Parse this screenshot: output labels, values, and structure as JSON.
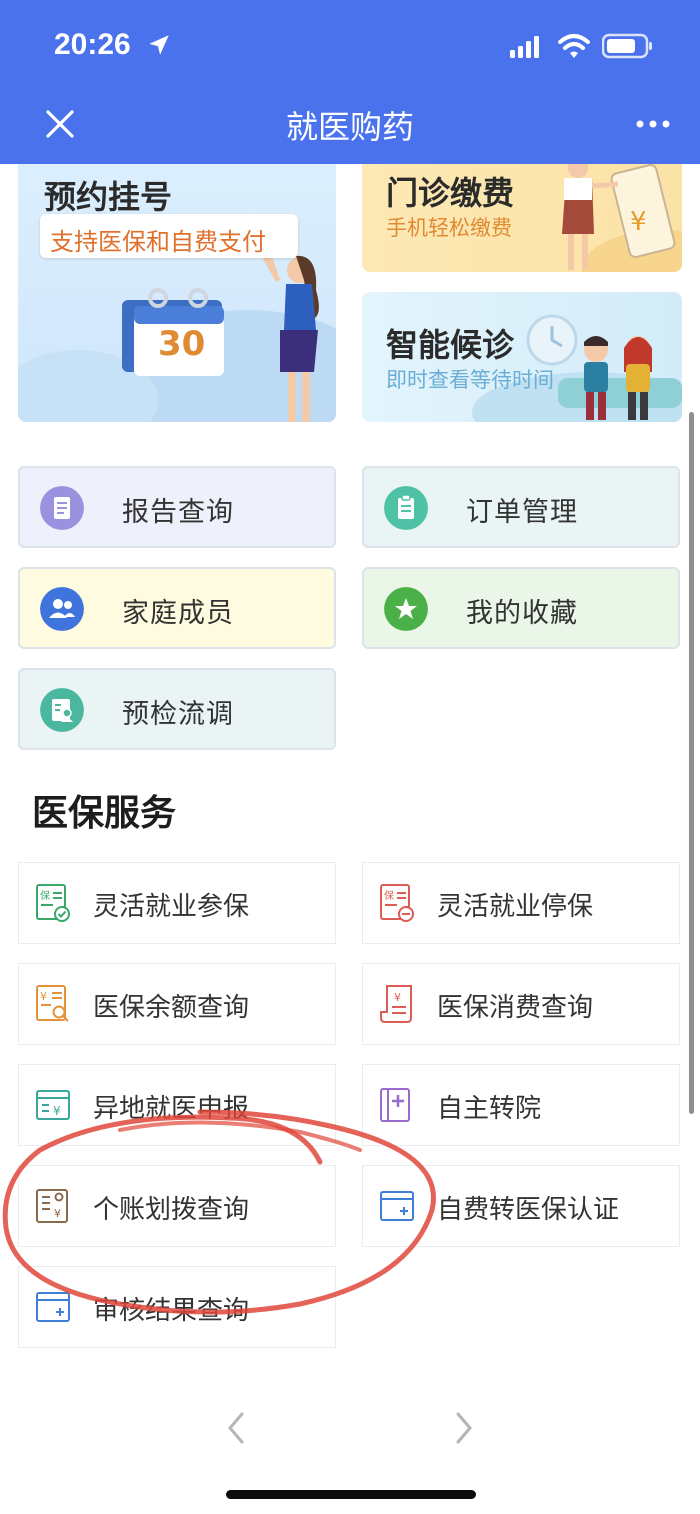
{
  "status": {
    "time": "20:26"
  },
  "nav": {
    "title": "就医购药"
  },
  "banners": {
    "appointment": {
      "title": "预约挂号",
      "subtitle": "支持医保和自费支付",
      "calendar": "30"
    },
    "payment": {
      "title": "门诊缴费",
      "subtitle": "手机轻松缴费"
    },
    "waiting": {
      "title": "智能候诊",
      "subtitle": "即时查看等待时间"
    }
  },
  "quick": {
    "report": "报告查询",
    "orders": "订单管理",
    "family": "家庭成员",
    "favorites": "我的收藏",
    "precheck": "预检流调"
  },
  "insurance": {
    "title": "医保服务",
    "items": [
      "灵活就业参保",
      "灵活就业停保",
      "医保余额查询",
      "医保消费查询",
      "异地就医申报",
      "自主转院",
      "个账划拨查询",
      "自费转医保认证",
      "审核结果查询"
    ]
  },
  "colors": {
    "header": "#4a72ec",
    "icon_orange": "#e3933a",
    "icon_red": "#dd5c54",
    "icon_teal": "#3aa79b",
    "icon_blue": "#3f7fd6",
    "icon_purple": "#9a6bcf",
    "annotation": "#e0473b"
  }
}
